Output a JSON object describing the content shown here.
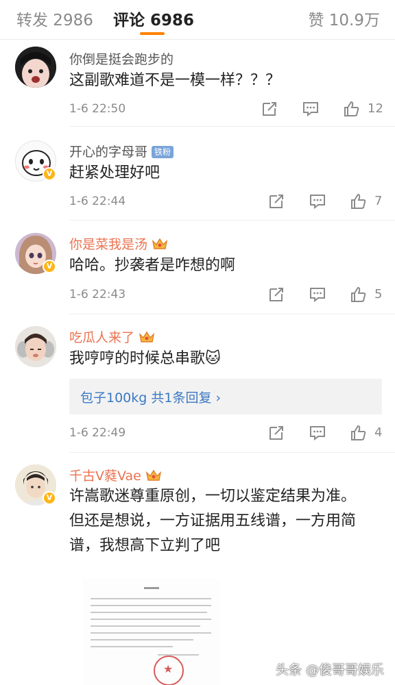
{
  "tabs": {
    "repost": "转发 2986",
    "comments": "评论 6986",
    "likes": "赞 10.9万"
  },
  "comments": [
    {
      "user": "你倒是挺会跑步的",
      "text": "这副歌难道不是一模一样？？？",
      "time": "1-6 22:50",
      "likes": "12"
    },
    {
      "user": "开心的字母哥",
      "badge": "铁粉",
      "text": "赶紧处理好吧",
      "time": "1-6 22:44",
      "likes": "7"
    },
    {
      "user": "你是菜我是汤",
      "text": "哈哈。抄袭者是咋想的啊",
      "time": "1-6 22:43",
      "likes": "5"
    },
    {
      "user": "吃瓜人来了",
      "text": "我哼哼的时候总串歌🐱",
      "reply_summary": "包子100kg  共1条回复 ›",
      "time": "1-6 22:49",
      "likes": "4"
    },
    {
      "user": "千古V蕤Vae",
      "text_lines": [
        "许嵩歌迷尊重原创，一切以鉴定结果为准。",
        "但还是想说，一方证据用五线谱，一方用简",
        "谱，我想高下立判了吧"
      ]
    }
  ],
  "watermark": "头条 @俊哥哥娱乐",
  "colors": {
    "accent": "#ff8200",
    "vip_name": "#eb7350",
    "link": "#3a78c3",
    "verified_badge": "#ffb515"
  },
  "icons": [
    "repost-icon",
    "comment-icon",
    "like-icon",
    "verified-icon",
    "crown-icon"
  ]
}
